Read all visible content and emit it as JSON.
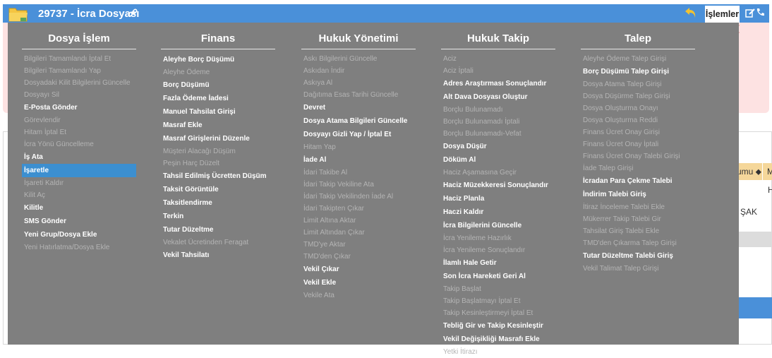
{
  "header": {
    "title": "29737 - İcra Dosyası",
    "actions_label": "İşlemler"
  },
  "background": {
    "col_header_1": "umu ⬥",
    "col_header_2": "M",
    "cell_h": "H",
    "cell_sak": "ŞAK"
  },
  "menu": {
    "columns": [
      {
        "title": "Dosya İşlem",
        "items": [
          {
            "label": "Bilgileri Tamamlandı İptal Et",
            "enabled": false
          },
          {
            "label": "Bilgileri Tamamlandı Yap",
            "enabled": false
          },
          {
            "label": "Dosyadaki Kilit Bilgilerini Güncelle",
            "enabled": false
          },
          {
            "label": "Dosyayı Sil",
            "enabled": false
          },
          {
            "label": "E-Posta Gönder",
            "enabled": true
          },
          {
            "label": "Görevlendir",
            "enabled": false
          },
          {
            "label": "Hitam İptal Et",
            "enabled": false
          },
          {
            "label": "İcra Yönü Güncelleme",
            "enabled": false
          },
          {
            "label": "İş Ata",
            "enabled": true
          },
          {
            "label": "İşaretle",
            "enabled": true,
            "selected": true
          },
          {
            "label": "İşareti Kaldır",
            "enabled": false
          },
          {
            "label": "Kilit Aç",
            "enabled": false
          },
          {
            "label": "Kilitle",
            "enabled": true
          },
          {
            "label": "SMS Gönder",
            "enabled": true
          },
          {
            "label": "Yeni Grup/Dosya Ekle",
            "enabled": true
          },
          {
            "label": "Yeni Hatırlatma/Dosya Ekle",
            "enabled": false
          }
        ]
      },
      {
        "title": "Finans",
        "items": [
          {
            "label": "Aleyhe Borç Düşümü",
            "enabled": true
          },
          {
            "label": "Aleyhe Ödeme",
            "enabled": false
          },
          {
            "label": "Borç Düşümü",
            "enabled": true
          },
          {
            "label": "Fazla Ödeme İadesi",
            "enabled": true
          },
          {
            "label": "Manuel Tahsilat Girişi",
            "enabled": true
          },
          {
            "label": "Masraf Ekle",
            "enabled": true
          },
          {
            "label": "Masraf Girişlerini Düzenle",
            "enabled": true
          },
          {
            "label": "Müşteri Alacağı Düşüm",
            "enabled": false
          },
          {
            "label": "Peşin Harç Düzelt",
            "enabled": false
          },
          {
            "label": "Tahsil Edilmiş Ücretten Düşüm",
            "enabled": true
          },
          {
            "label": "Taksit Görüntüle",
            "enabled": true
          },
          {
            "label": "Taksitlendirme",
            "enabled": true
          },
          {
            "label": "Terkin",
            "enabled": true
          },
          {
            "label": "Tutar Düzeltme",
            "enabled": true
          },
          {
            "label": "Vekalet Ücretinden Feragat",
            "enabled": false
          },
          {
            "label": "Vekil Tahsilatı",
            "enabled": true
          }
        ]
      },
      {
        "title": "Hukuk Yönetimi",
        "items": [
          {
            "label": "Askı Bilgilerini Güncelle",
            "enabled": false
          },
          {
            "label": "Askıdan İndir",
            "enabled": false
          },
          {
            "label": "Askıya Al",
            "enabled": false
          },
          {
            "label": "Dağıtıma Esas Tarihi Güncelle",
            "enabled": false
          },
          {
            "label": "Devret",
            "enabled": true
          },
          {
            "label": "Dosya Atama Bilgileri Güncelle",
            "enabled": true
          },
          {
            "label": "Dosyayı Gizli Yap / İptal Et",
            "enabled": true
          },
          {
            "label": "Hitam Yap",
            "enabled": false
          },
          {
            "label": "İade Al",
            "enabled": true
          },
          {
            "label": "İdari Takibe Al",
            "enabled": false
          },
          {
            "label": "İdari Takip Vekiline Ata",
            "enabled": false
          },
          {
            "label": "İdari Takip Vekilinden İade Al",
            "enabled": false
          },
          {
            "label": "İdari Takipten Çıkar",
            "enabled": false
          },
          {
            "label": "Limit Altına Aktar",
            "enabled": false
          },
          {
            "label": "Limit Altından Çıkar",
            "enabled": false
          },
          {
            "label": "TMD'ye Aktar",
            "enabled": false
          },
          {
            "label": "TMD'den Çıkar",
            "enabled": false
          },
          {
            "label": "Vekil Çıkar",
            "enabled": true
          },
          {
            "label": "Vekil Ekle",
            "enabled": true
          },
          {
            "label": "Vekile Ata",
            "enabled": false
          }
        ]
      },
      {
        "title": "Hukuk Takip",
        "items": [
          {
            "label": "Aciz",
            "enabled": false
          },
          {
            "label": "Aciz İptali",
            "enabled": false
          },
          {
            "label": "Adres Araştırması Sonuçlandır",
            "enabled": true
          },
          {
            "label": "Alt Dava Dosyası Oluştur",
            "enabled": true
          },
          {
            "label": "Borçlu Bulunamadı",
            "enabled": false
          },
          {
            "label": "Borçlu Bulunamadı İptali",
            "enabled": false
          },
          {
            "label": "Borçlu Bulunamadı-Vefat",
            "enabled": false
          },
          {
            "label": "Dosya Düşür",
            "enabled": true
          },
          {
            "label": "Döküm Al",
            "enabled": true
          },
          {
            "label": "Haciz Aşamasına Geçir",
            "enabled": false
          },
          {
            "label": "Haciz Müzekkeresi Sonuçlandır",
            "enabled": true
          },
          {
            "label": "Haciz Planla",
            "enabled": true
          },
          {
            "label": "Haczi Kaldır",
            "enabled": true
          },
          {
            "label": "İcra Bilgilerini Güncelle",
            "enabled": true
          },
          {
            "label": "İcra Yenileme Hazırlık",
            "enabled": false
          },
          {
            "label": "İcra Yenileme Sonuçlandır",
            "enabled": false
          },
          {
            "label": "İlamlı Hale Getir",
            "enabled": true
          },
          {
            "label": "Son İcra Hareketi Geri Al",
            "enabled": true
          },
          {
            "label": "Takip Başlat",
            "enabled": false
          },
          {
            "label": "Takip Başlatmayı İptal Et",
            "enabled": false
          },
          {
            "label": "Takip Kesinleştirmeyi İptal Et",
            "enabled": false
          },
          {
            "label": "Tebliğ Gir ve Takip Kesinleştir",
            "enabled": true
          },
          {
            "label": "Vekil Değişikliği Masrafı Ekle",
            "enabled": true
          },
          {
            "label": "Yetki İtirazı",
            "enabled": false
          }
        ]
      },
      {
        "title": "Talep",
        "items": [
          {
            "label": "Aleyhe Ödeme Talep Girişi",
            "enabled": false
          },
          {
            "label": "Borç Düşümü Talep Girişi",
            "enabled": true
          },
          {
            "label": "Dosya Atama Talep Girişi",
            "enabled": false
          },
          {
            "label": "Dosya Düşürme Talep Girişi",
            "enabled": false
          },
          {
            "label": "Dosya Oluşturma Onayı",
            "enabled": false
          },
          {
            "label": "Dosya Oluşturma Reddi",
            "enabled": false
          },
          {
            "label": "Finans Ücret Onay Girişi",
            "enabled": false
          },
          {
            "label": "Finans Ücret Onay İptali",
            "enabled": false
          },
          {
            "label": "Finans Ücret Onay Talebi Girişi",
            "enabled": false
          },
          {
            "label": "İade Talep Girişi",
            "enabled": false
          },
          {
            "label": "İcradan Para Çekme Talebi",
            "enabled": true
          },
          {
            "label": "İndirim Talebi Giriş",
            "enabled": true
          },
          {
            "label": "İtiraz İnceleme Talebi Ekle",
            "enabled": false
          },
          {
            "label": "Mükerrer Takip Talebi Gir",
            "enabled": false
          },
          {
            "label": "Tahsilat Giriş Talebi Ekle",
            "enabled": false
          },
          {
            "label": "TMD'den Çıkarma Talep Girişi",
            "enabled": false
          },
          {
            "label": "Tutar Düzeltme Talebi Giriş",
            "enabled": true
          },
          {
            "label": "Vekil Talimat Talep Girişi",
            "enabled": false
          }
        ]
      }
    ]
  }
}
